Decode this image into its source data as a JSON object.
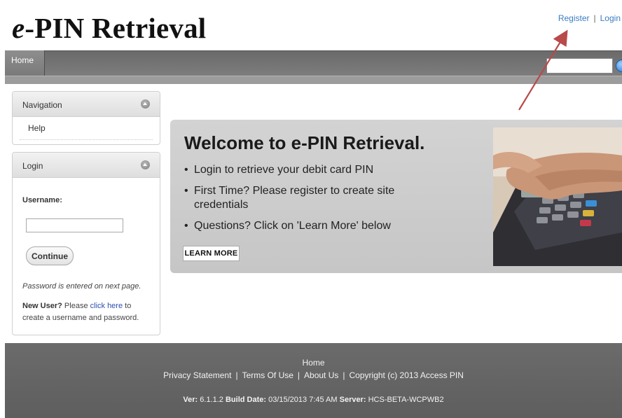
{
  "header": {
    "logo_prefix": "e",
    "logo_rest": "-PIN Retrieval",
    "register_label": "Register",
    "separator": "|",
    "login_label": "Login"
  },
  "nav": {
    "home_tab": "Home",
    "search_placeholder": ""
  },
  "sidebar": {
    "navigation_title": "Navigation",
    "navigation_items": [
      {
        "label": "Help"
      }
    ],
    "login_title": "Login",
    "username_label": "Username:",
    "continue_label": "Continue",
    "password_note": "Password is entered on next page.",
    "new_user_label": "New User?",
    "new_user_text": "Please",
    "click_here_label": "click here",
    "new_user_text_2": "to create a username and password."
  },
  "banner": {
    "title": "Welcome to e-PIN Retrieval.",
    "bullets": [
      "Login to retrieve your debit card PIN",
      "First Time?  Please register to create site credentials",
      "Questions?  Click on 'Learn More' below"
    ],
    "learn_more_label": "LEARN MORE"
  },
  "footer": {
    "home_label": "Home",
    "privacy_label": "Privacy Statement",
    "terms_label": "Terms Of Use",
    "about_label": "About Us",
    "copyright": "Copyright (c) 2013 Access PIN",
    "separator": "|",
    "ver_label": "Ver:",
    "ver_value": "6.1.1.2",
    "build_label": "Build Date:",
    "build_value": "03/15/2013 7:45 AM",
    "server_label": "Server:",
    "server_value": "HCS-BETA-WCPWB2"
  },
  "colors": {
    "link_blue": "#3a7cc4",
    "nav_gray": "#6e6e6e",
    "footer_gray": "#646464",
    "banner_gray": "#cccccc",
    "annotation_arrow": "#b84a4a"
  },
  "icons": {
    "search_button": "search-go-icon",
    "panel_toggle": "chevron-up-circle-icon"
  }
}
